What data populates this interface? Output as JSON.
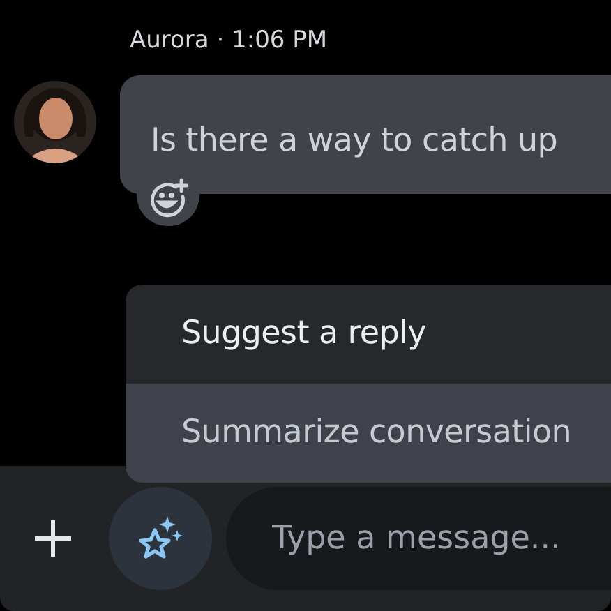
{
  "message": {
    "header": "Aurora · 1:06 PM",
    "text": "Is there a way to catch up"
  },
  "menu": [
    {
      "label": "Suggest a reply",
      "selected": false
    },
    {
      "label": "Summarize conversation",
      "selected": true
    }
  ],
  "composer": {
    "placeholder": "Type a message..."
  }
}
